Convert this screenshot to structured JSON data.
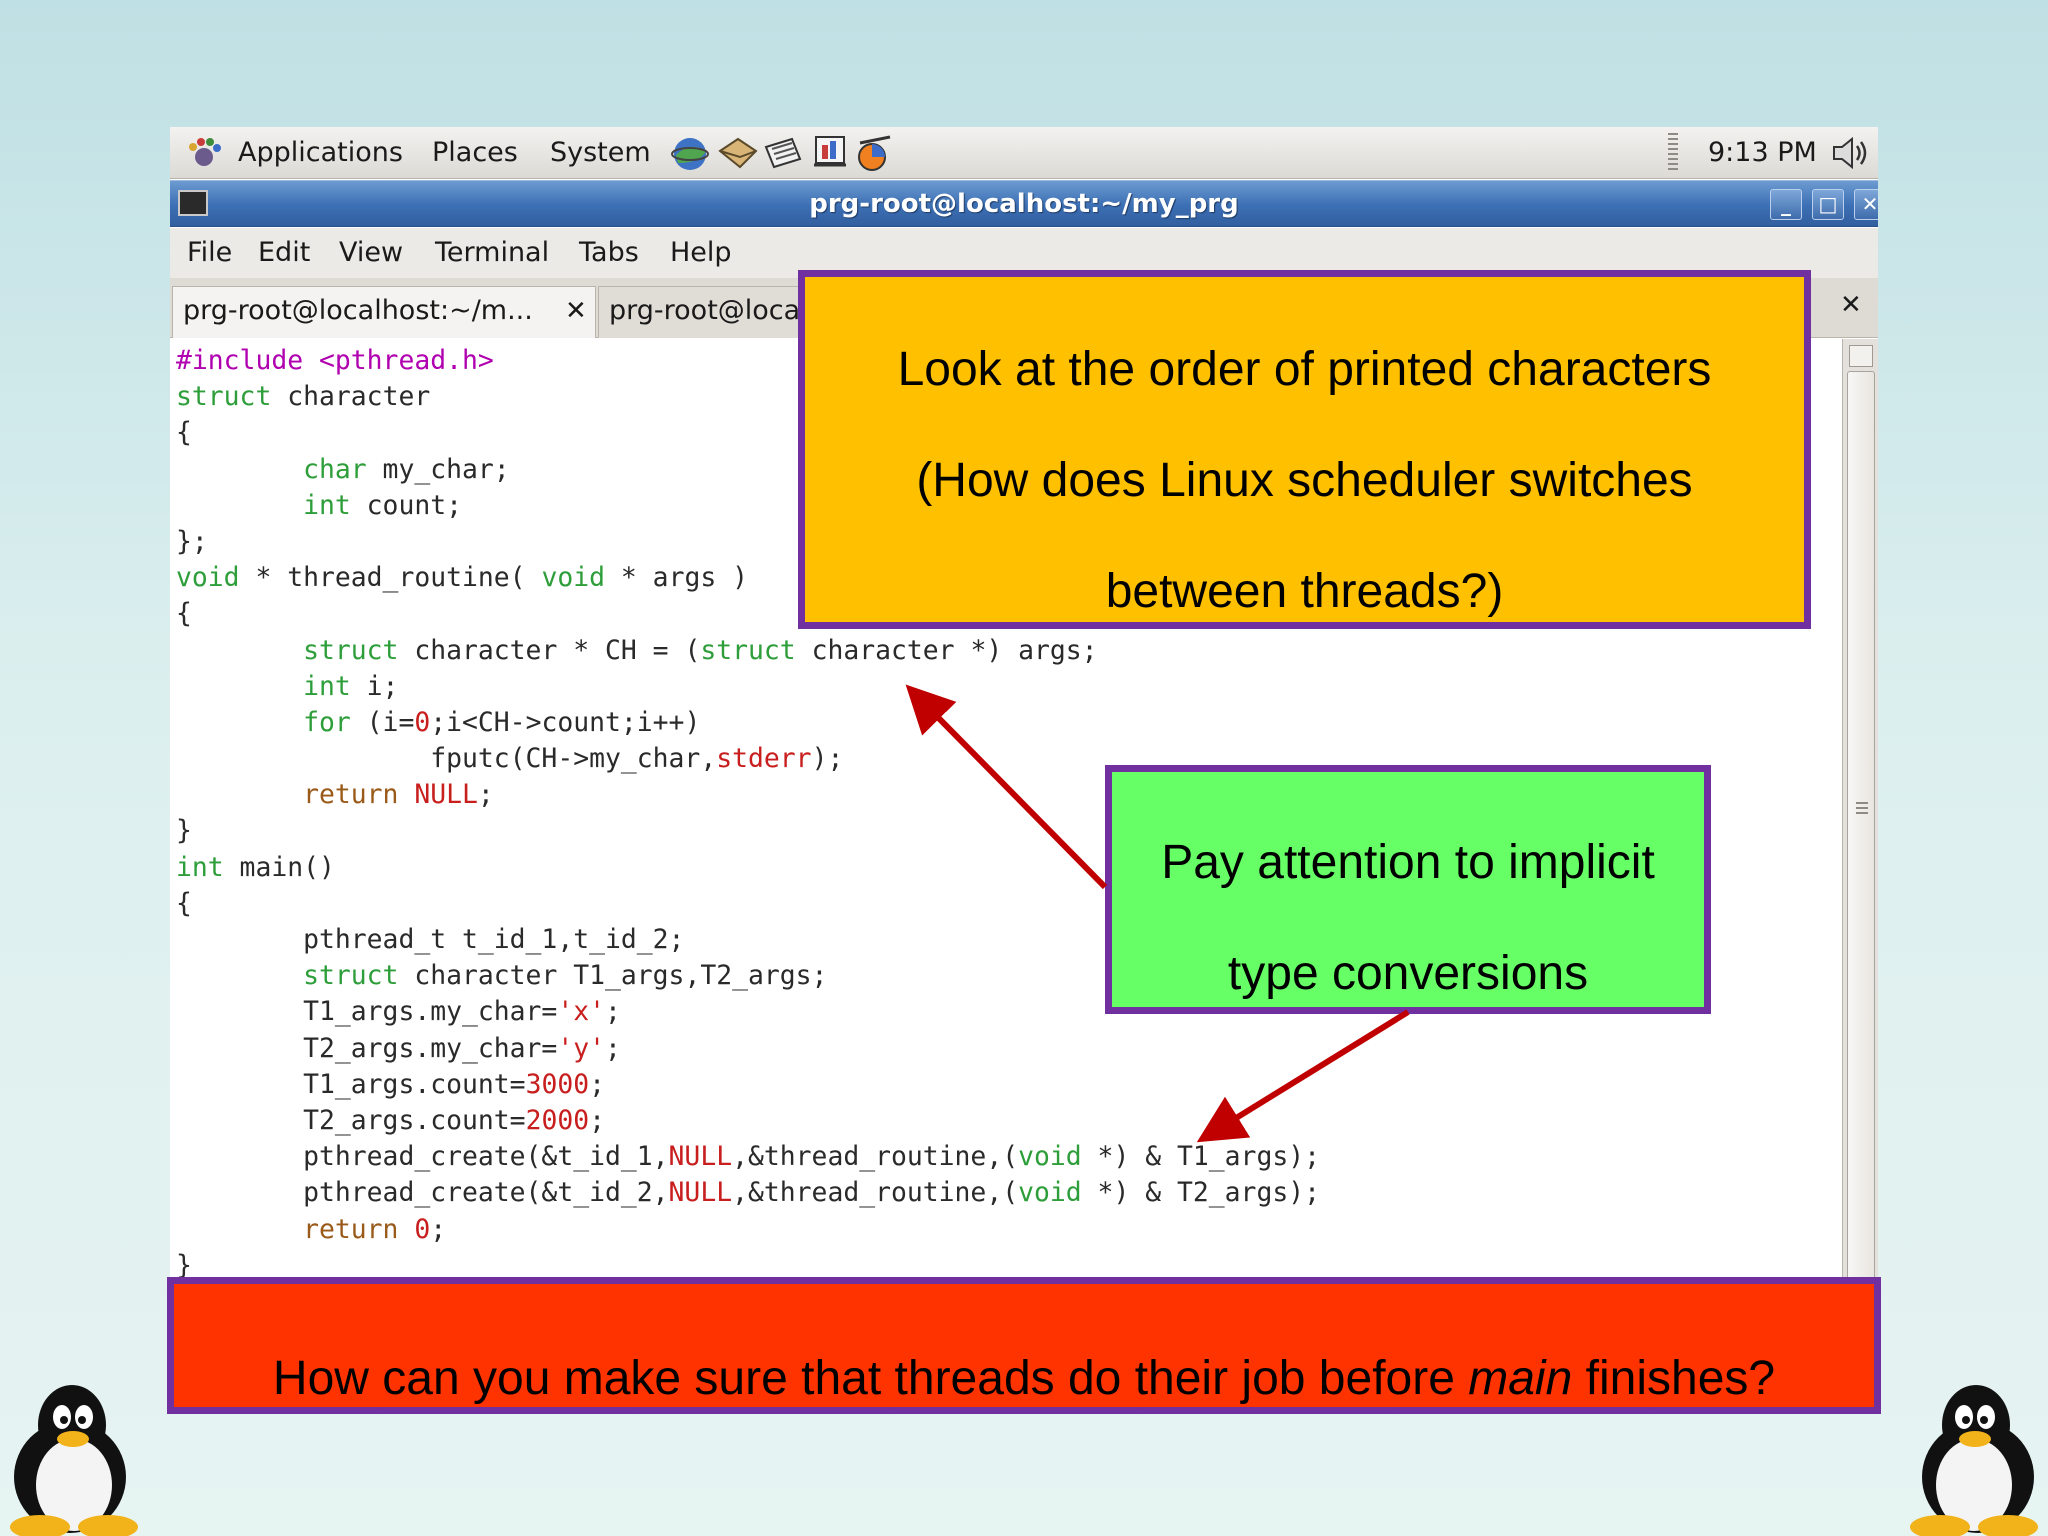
{
  "panel": {
    "menus": [
      "Applications",
      "Places",
      "System"
    ],
    "clock": "9:13 PM",
    "icons": [
      "applications-foot-icon",
      "web-browser-icon",
      "mail-icon",
      "text-editor-icon",
      "presentation-icon",
      "network-icon",
      "volume-icon"
    ]
  },
  "window": {
    "title": "prg-root@localhost:~/my_prg",
    "buttons": {
      "minimize": "_",
      "maximize": "□",
      "close": "✕"
    }
  },
  "menubar": [
    "File",
    "Edit",
    "View",
    "Terminal",
    "Tabs",
    "Help"
  ],
  "tabs": [
    {
      "label": "prg-root@localhost:~/m...",
      "close": "✕"
    },
    {
      "label": "prg-root@loca"
    }
  ],
  "tabbar_close": "✕",
  "code_lines": [
    [
      [
        "p",
        "#include <pthread.h>"
      ]
    ],
    [
      [
        "k",
        "struct"
      ],
      [
        "",
        " character"
      ]
    ],
    [
      [
        "",
        "{"
      ]
    ],
    [
      [
        "",
        "        "
      ],
      [
        "k",
        "char"
      ],
      [
        "",
        " my_char;"
      ]
    ],
    [
      [
        "",
        "        "
      ],
      [
        "k",
        "int"
      ],
      [
        "",
        " count;"
      ]
    ],
    [
      [
        "",
        "};"
      ]
    ],
    [
      [
        "k",
        "void"
      ],
      [
        "",
        " * thread_routine( "
      ],
      [
        "k",
        "void"
      ],
      [
        "",
        " * args )"
      ]
    ],
    [
      [
        "",
        "{"
      ]
    ],
    [
      [
        "",
        "        "
      ],
      [
        "k",
        "struct"
      ],
      [
        "",
        " character * CH = ("
      ],
      [
        "k",
        "struct"
      ],
      [
        "",
        " character *) args;"
      ]
    ],
    [
      [
        "",
        "        "
      ],
      [
        "k",
        "int"
      ],
      [
        "",
        " i;"
      ]
    ],
    [
      [
        "",
        "        "
      ],
      [
        "k",
        "for"
      ],
      [
        "",
        " (i="
      ],
      [
        "s",
        "0"
      ],
      [
        "",
        ";i<CH->count;i++)"
      ]
    ],
    [
      [
        "",
        "                fputc(CH->my_char,"
      ],
      [
        "s",
        "stderr"
      ],
      [
        "",
        ");"
      ]
    ],
    [
      [
        "",
        "        "
      ],
      [
        "r",
        "return"
      ],
      [
        "",
        " "
      ],
      [
        "s",
        "NULL"
      ],
      [
        "",
        ";"
      ]
    ],
    [
      [
        "",
        "}"
      ]
    ],
    [
      [
        "k",
        "int"
      ],
      [
        "",
        " main()"
      ]
    ],
    [
      [
        "",
        "{"
      ]
    ],
    [
      [
        "",
        "        pthread_t t_id_1,t_id_2;"
      ]
    ],
    [
      [
        "",
        "        "
      ],
      [
        "k",
        "struct"
      ],
      [
        "",
        " character T1_args,T2_args;"
      ]
    ],
    [
      [
        "",
        "        T1_args.my_char="
      ],
      [
        "s",
        "'x'"
      ],
      [
        "",
        ";"
      ]
    ],
    [
      [
        "",
        "        T2_args.my_char="
      ],
      [
        "s",
        "'y'"
      ],
      [
        "",
        ";"
      ]
    ],
    [
      [
        "",
        "        T1_args.count="
      ],
      [
        "s",
        "3000"
      ],
      [
        "",
        ";"
      ]
    ],
    [
      [
        "",
        "        T2_args.count="
      ],
      [
        "s",
        "2000"
      ],
      [
        "",
        ";"
      ]
    ],
    [
      [
        "",
        "        pthread_create(&t_id_1,"
      ],
      [
        "s",
        "NULL"
      ],
      [
        "",
        ",&thread_routine,("
      ],
      [
        "k",
        "void"
      ],
      [
        "",
        " *) & T1_args);"
      ]
    ],
    [
      [
        "",
        "        pthread_create(&t_id_2,"
      ],
      [
        "s",
        "NULL"
      ],
      [
        "",
        ",&thread_routine,("
      ],
      [
        "k",
        "void"
      ],
      [
        "",
        " *) & T2_args);"
      ]
    ],
    [
      [
        "",
        "        "
      ],
      [
        "r",
        "return"
      ],
      [
        "",
        " "
      ],
      [
        "s",
        "0"
      ],
      [
        "",
        ";"
      ]
    ],
    [
      [
        "",
        "}"
      ]
    ]
  ],
  "callouts": {
    "yellow": [
      "Look at the order of printed characters",
      "(How does Linux scheduler switches",
      "between threads?)"
    ],
    "green": [
      "Pay attention to implicit",
      "type conversions"
    ],
    "red": {
      "before": "How can you make sure that threads do their job before ",
      "italic": "main",
      "after": "  finishes?"
    }
  },
  "colors": {
    "yellow": "#ffc000",
    "green": "#66ff66",
    "red": "#ff3300",
    "border": "#7030a0",
    "arrow": "#c00000",
    "keyword": "#2e9e3a",
    "literal": "#c81e1e"
  }
}
